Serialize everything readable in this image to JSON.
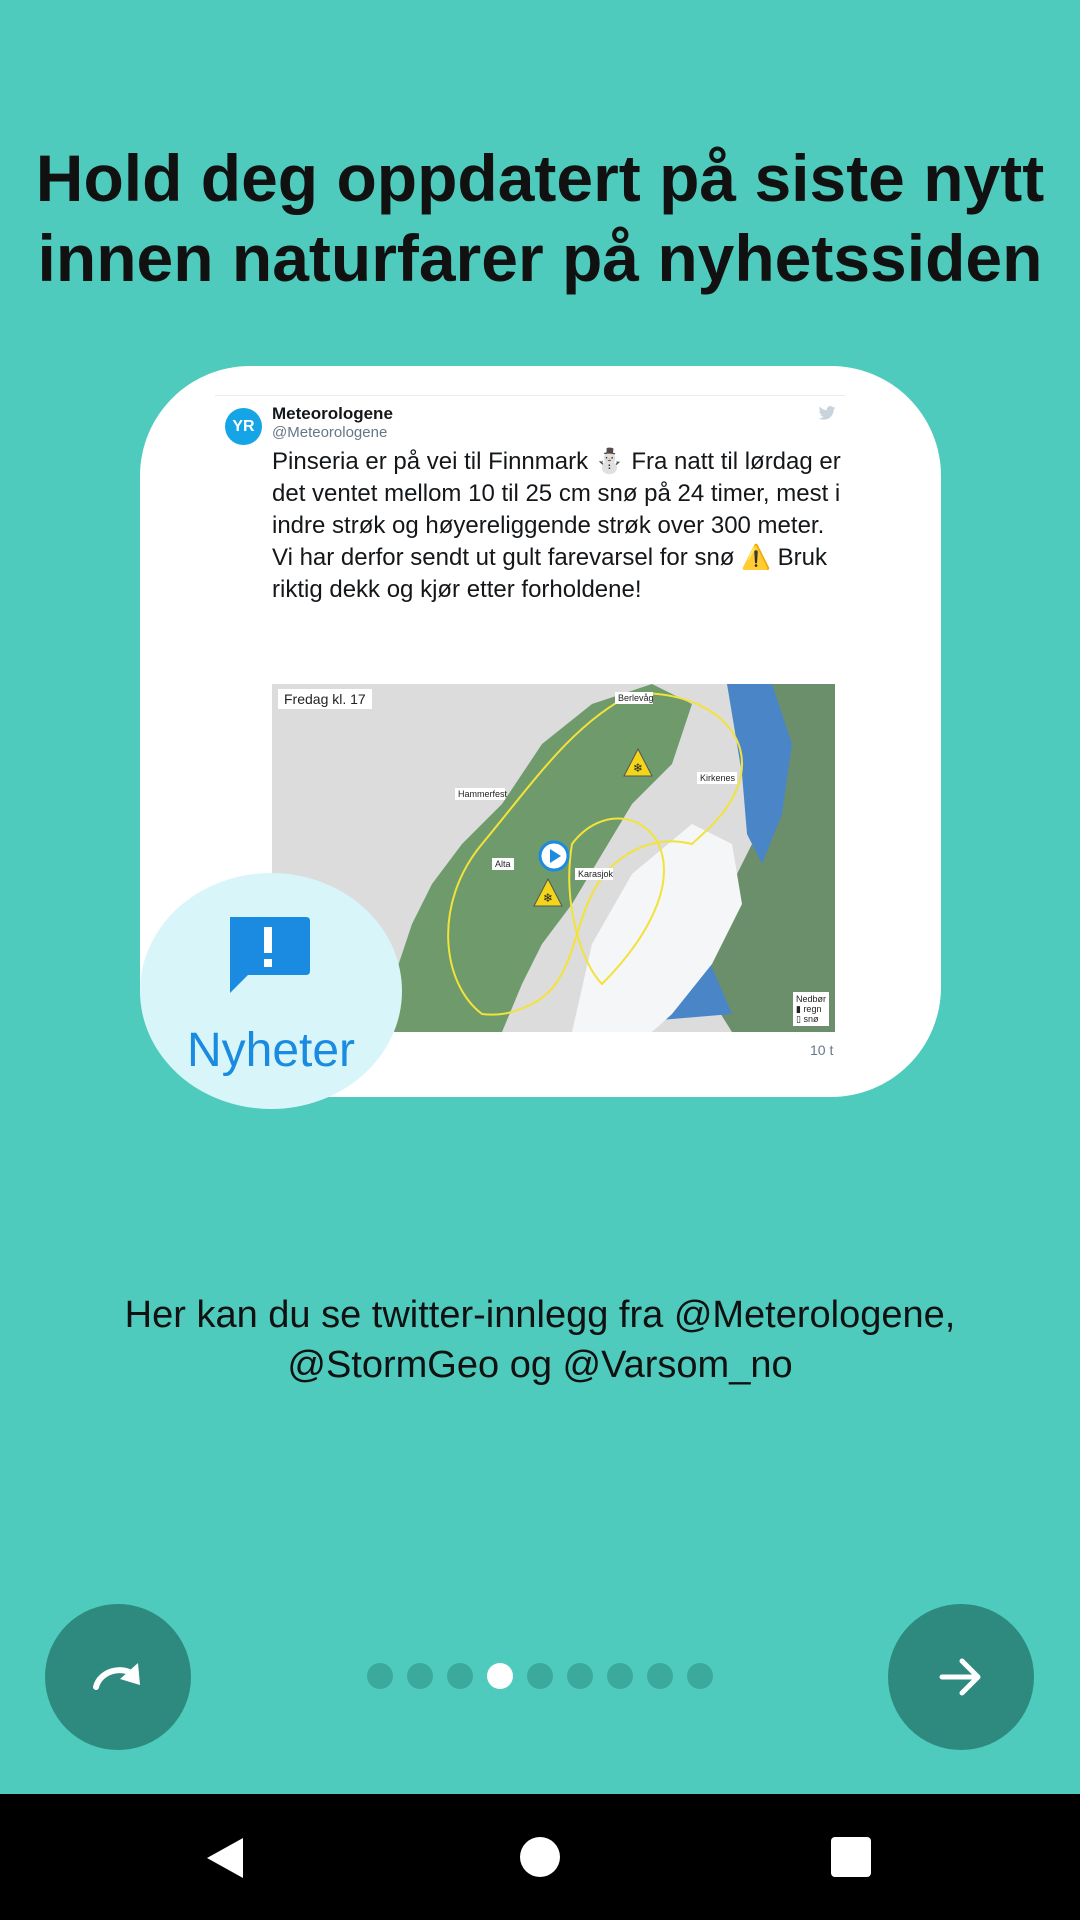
{
  "headline": "Hold deg oppdatert på siste nytt innen naturfarer på nyhetssiden",
  "tweet": {
    "avatar_text": "YR",
    "name": "Meteorologene",
    "handle": "@Meteorologene",
    "text": "Pinseria er på vei til Finnmark ⛄ Fra natt til lørdag er det ventet mellom 10 til 25 cm snø på 24 timer, mest i indre strøk og høyereliggende strøk over 300 meter. Vi har derfor sendt ut gult farevarsel for snø ⚠️ Bruk riktig dekk og kjør etter forholdene!",
    "map_label": "Fredag kl. 17",
    "map_places": [
      "Berlevåg",
      "Kirkenes",
      "Hammerfest",
      "Alta",
      "Karasjok"
    ],
    "legend_title": "Nedbør",
    "legend_items": [
      "regn",
      "snø"
    ],
    "time": "10 t"
  },
  "badge": {
    "label": "Nyheter",
    "icon": "news-alert-icon"
  },
  "subtitle_line1": "Her kan du se twitter-innlegg fra @Meterologene,",
  "subtitle_line2": "@StormGeo og @Varsom_no",
  "pager": {
    "total": 9,
    "active": 4
  },
  "buttons": {
    "skip_icon": "skip-icon",
    "next_icon": "arrow-right-icon"
  },
  "colors": {
    "background": "#4ecbbc",
    "button": "#2e8a7f",
    "accent": "#1a8be0"
  }
}
